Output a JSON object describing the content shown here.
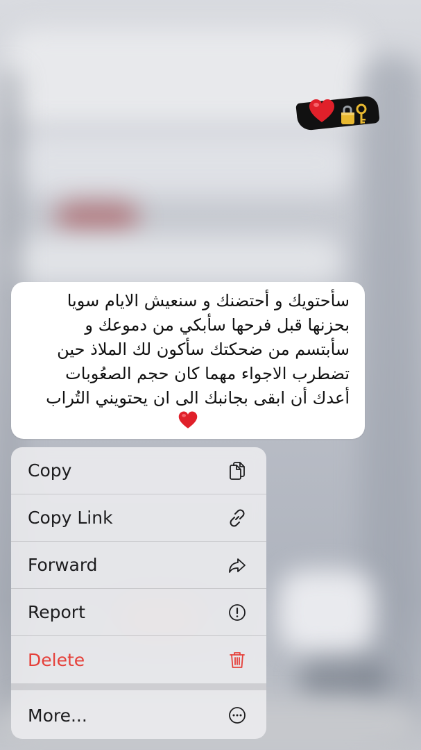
{
  "message": {
    "lines": [
      "سأحتويك و أحتضنك و سنعيش الايام سويا",
      "بحزنها قبل فرحها سأبكي من دموعك و",
      "سأبتسم من ضحكتك سأكون لك الملاذ حين",
      "تضطرب الاجواء مهما كان حجم الصعُوبات",
      "أعدك أن ابقى بجانبك الى ان يحتويني التُراب"
    ],
    "trailing_emoji": "red-heart"
  },
  "sticker": {
    "emojis": [
      "red-heart",
      "locked-with-key"
    ]
  },
  "menu": {
    "items": [
      {
        "label": "Copy",
        "icon": "copy-icon"
      },
      {
        "label": "Copy Link",
        "icon": "link-icon"
      },
      {
        "label": "Forward",
        "icon": "forward-icon"
      },
      {
        "label": "Report",
        "icon": "report-icon"
      },
      {
        "label": "Delete",
        "icon": "trash-icon",
        "color": "#e5403a"
      },
      {
        "label": "More...",
        "icon": "more-icon"
      }
    ]
  },
  "colors": {
    "danger": "#e5403a",
    "bubble": "#ffffff",
    "heart": "#e0202a"
  }
}
